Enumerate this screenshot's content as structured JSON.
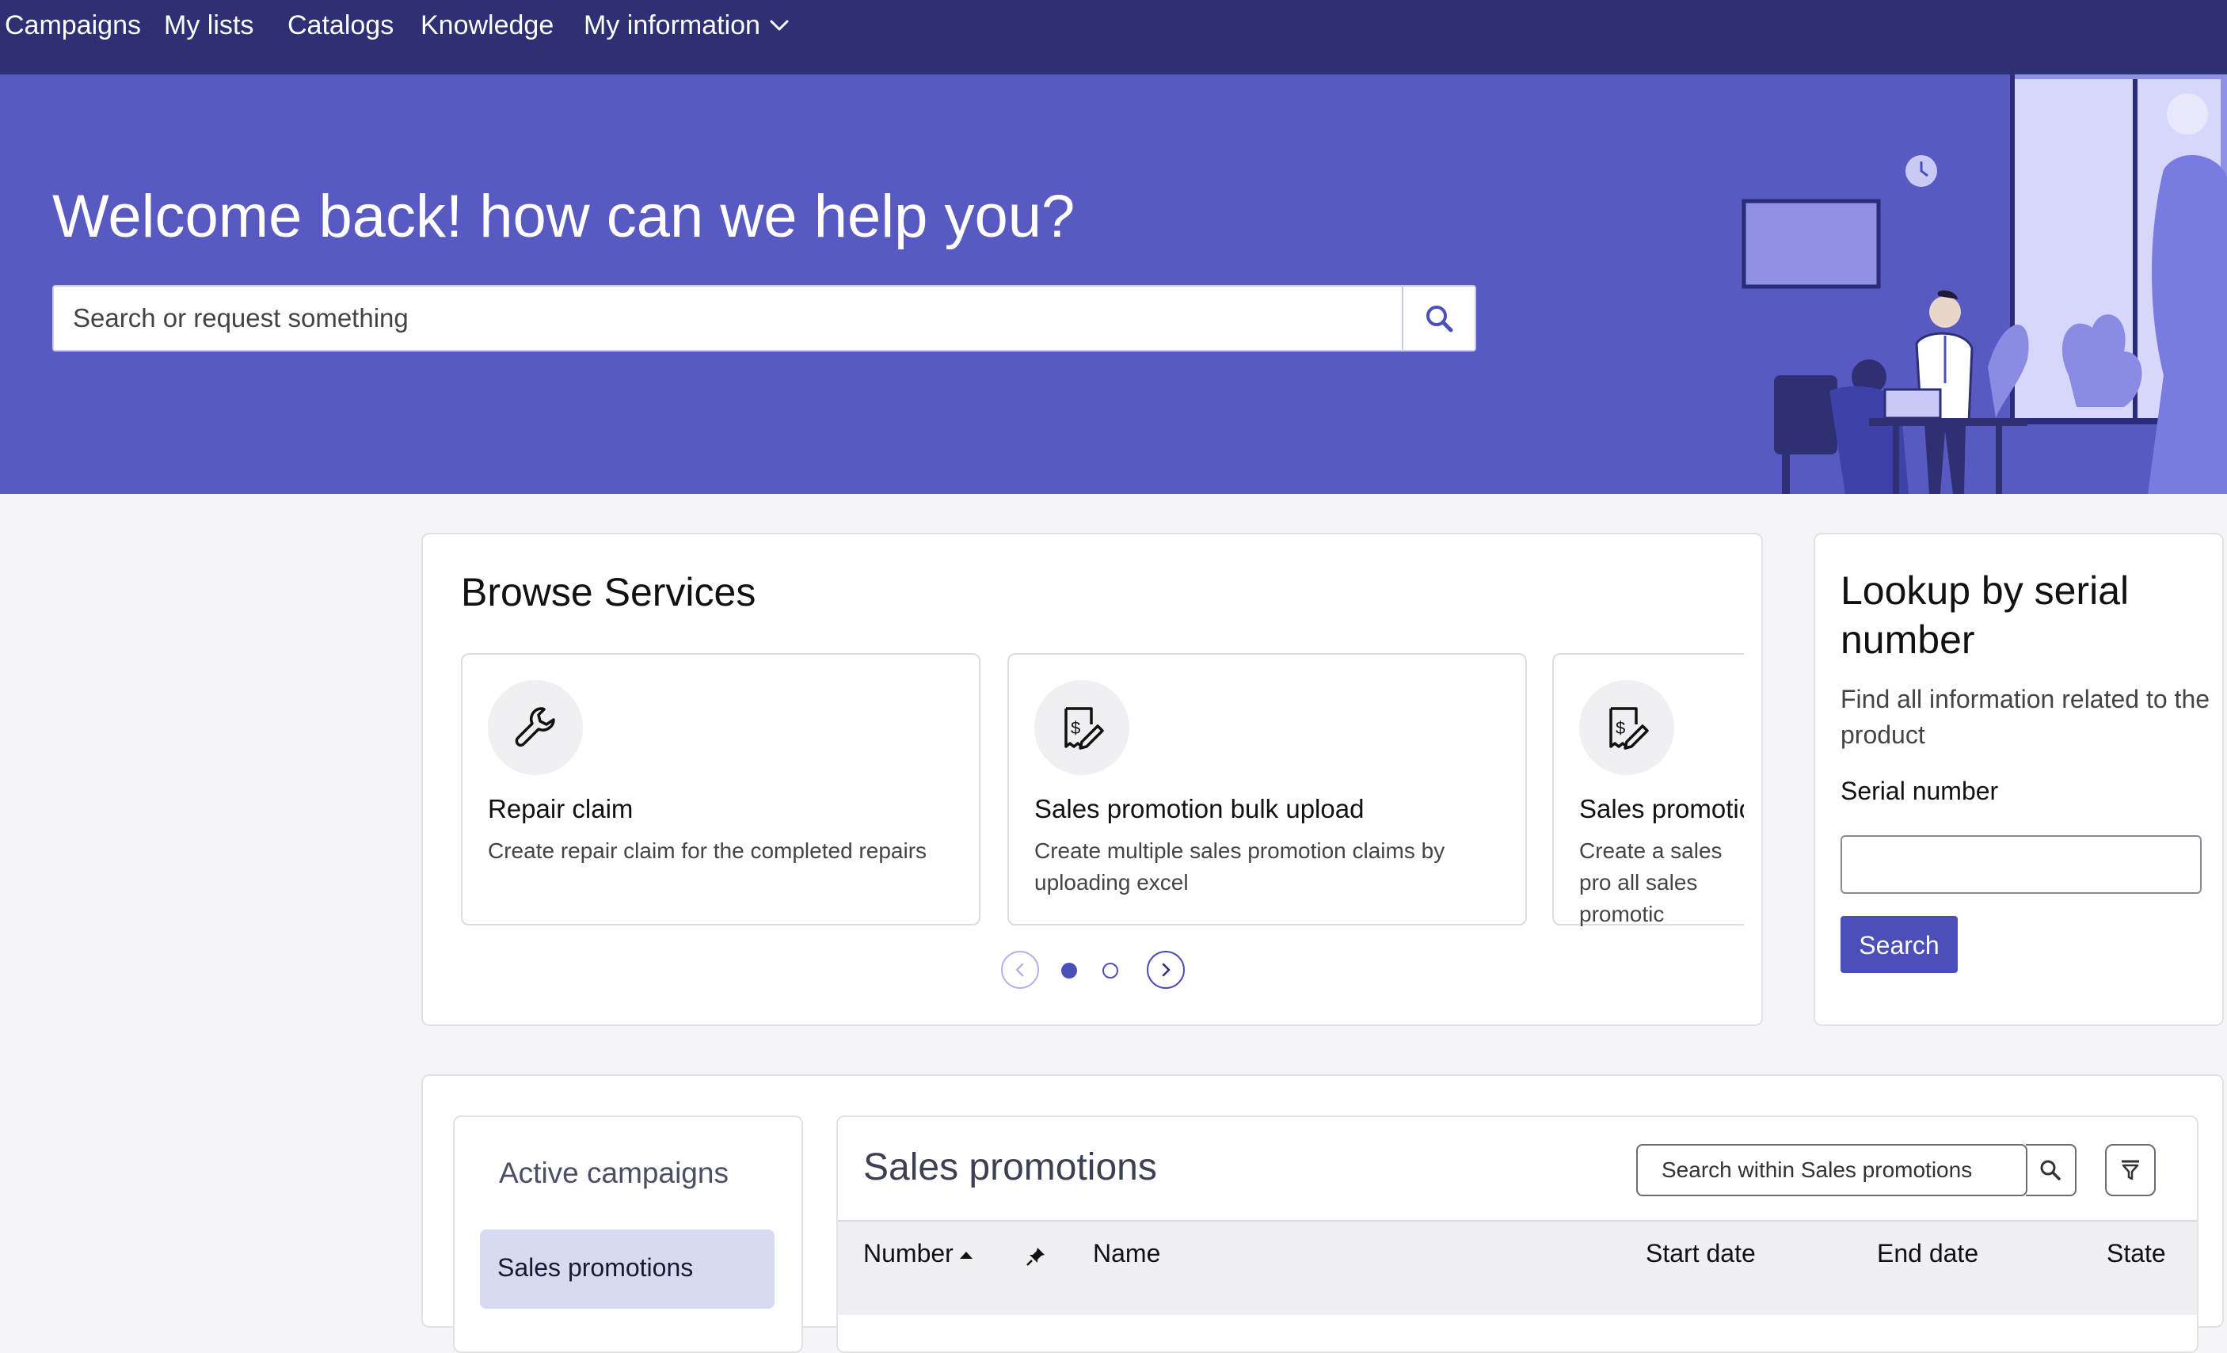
{
  "nav": {
    "items": [
      {
        "label": "Campaigns"
      },
      {
        "label": "My lists"
      },
      {
        "label": "Catalogs"
      },
      {
        "label": "Knowledge"
      },
      {
        "label": "My information"
      }
    ]
  },
  "hero": {
    "title": "Welcome back! how can we help you?",
    "search_placeholder": "Search or request something",
    "search_icon": "search-icon"
  },
  "browse": {
    "title": "Browse Services",
    "cards": [
      {
        "icon": "wrench-icon",
        "title": "Repair claim",
        "description": "Create repair claim for the completed repairs"
      },
      {
        "icon": "receipt-pen-icon",
        "title": "Sales promotion bulk upload",
        "description": "Create multiple sales promotion claims by uploading excel"
      },
      {
        "icon": "receipt-pen-icon",
        "title": "Sales promotio",
        "description": "Create a sales pro all sales promotic"
      }
    ],
    "pagination": {
      "current_page": 1,
      "total_pages": 2
    }
  },
  "lookup": {
    "title": "Lookup by serial number",
    "description": "Find all information related to the product",
    "field_label": "Serial number",
    "field_value": "",
    "button_label": "Search"
  },
  "campaigns": {
    "title": "Active campaigns",
    "items": [
      {
        "label": "Sales promotions",
        "selected": true
      }
    ]
  },
  "sales": {
    "title": "Sales promotions",
    "search_placeholder": "Search within Sales promotions",
    "columns": [
      {
        "label": "Number",
        "sort": "ascending"
      },
      {
        "label": "",
        "icon": "pin-icon"
      },
      {
        "label": "Name"
      },
      {
        "label": "Start date"
      },
      {
        "label": "End date"
      },
      {
        "label": "State"
      }
    ]
  },
  "colors": {
    "nav_bg": "#2e3073",
    "hero_bg": "#5859c1",
    "accent": "#4d4fb8",
    "selected_bg": "#d8d9f3"
  }
}
